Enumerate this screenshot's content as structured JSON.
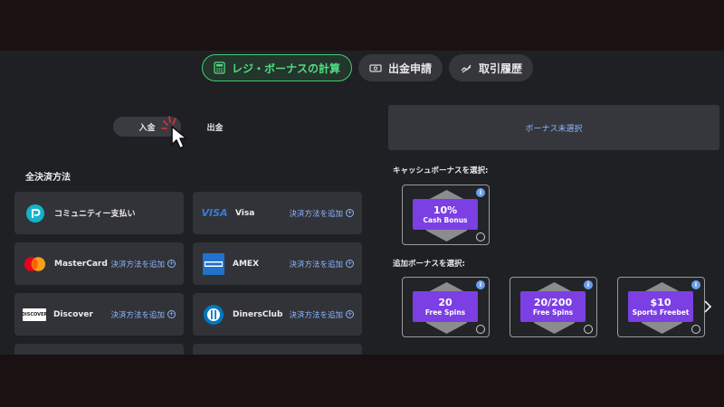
{
  "tabs": [
    {
      "label": "レジ・ボーナスの計算",
      "icon": "calculator-icon",
      "active": true
    },
    {
      "label": "出金申請",
      "icon": "cash-icon",
      "active": false
    },
    {
      "label": "取引履歴",
      "icon": "history-icon",
      "active": false
    }
  ],
  "toggle": {
    "deposit": "入金",
    "withdraw": "出金",
    "selected": "deposit"
  },
  "payments": {
    "title": "全決済方法",
    "add_label": "決済方法を追加",
    "items": [
      {
        "name": "コミュニティー支払い",
        "icon": "community-pay-icon"
      },
      {
        "name": "Visa",
        "icon": "visa-logo-icon",
        "logo_text": "VISA"
      },
      {
        "name": "MasterCard",
        "icon": "mastercard-logo-icon"
      },
      {
        "name": "AMEX",
        "icon": "amex-logo-icon"
      },
      {
        "name": "Discover",
        "icon": "discover-logo-icon",
        "logo_text": "DISCOVER"
      },
      {
        "name": "DinersClub",
        "icon": "dinersclub-logo-icon"
      }
    ]
  },
  "bonus": {
    "none_selected": "ボーナス未選択",
    "cash_label": "キャッシュボーナスを選択:",
    "extra_label": "追加ボーナスを選択:",
    "cash_bonuses": [
      {
        "amount": "10%",
        "type": "Cash Bonus"
      }
    ],
    "extra_bonuses": [
      {
        "amount": "20",
        "type": "Free Spins"
      },
      {
        "amount": "20/200",
        "type": "Free Spins"
      },
      {
        "amount": "$10",
        "type": "Sports Freebet"
      }
    ],
    "info_badge": "i"
  },
  "colors": {
    "accent_green": "#3fcf72",
    "link_blue": "#8bb6ff",
    "ticket_purple": "#7b3fe4",
    "panel": "#323338"
  }
}
